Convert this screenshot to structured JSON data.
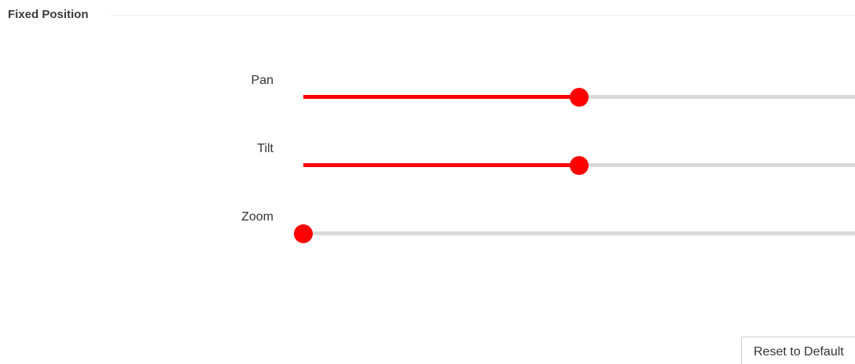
{
  "section": {
    "title": "Fixed Position"
  },
  "sliders": [
    {
      "label": "Pan",
      "value_percent": 50
    },
    {
      "label": "Tilt",
      "value_percent": 50
    },
    {
      "label": "Zoom",
      "value_percent": 0
    }
  ],
  "reset_button": {
    "label": "Reset to Default"
  },
  "colors": {
    "accent": "#ff0000",
    "track": "#d9d9d9"
  }
}
